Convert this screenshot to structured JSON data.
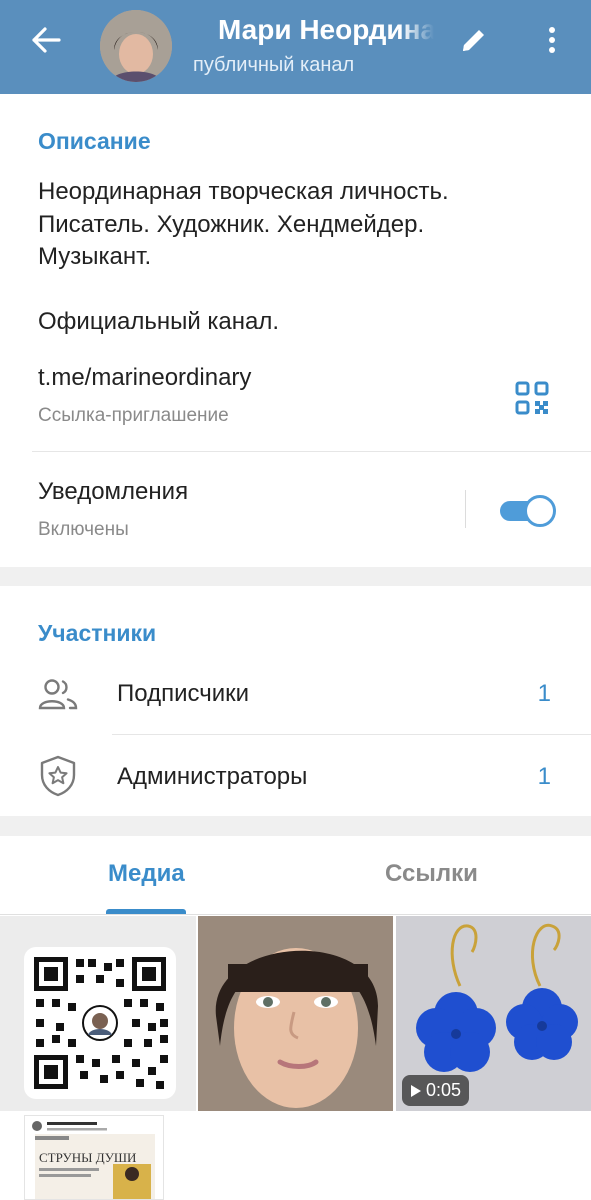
{
  "header": {
    "title": "Мари Неордина",
    "subtitle": "публичный канал"
  },
  "info": {
    "section_title": "Описание",
    "description_lines": [
      "Неординарная творческая личность.",
      "Писатель. Художник. Хендмейдер.",
      "Музыкант.",
      "Официальный канал."
    ],
    "link": "t.me/marineordinary",
    "link_caption": "Ссылка-приглашение",
    "notifications_label": "Уведомления",
    "notifications_status": "Включены",
    "notifications_on": true
  },
  "members": {
    "section_title": "Участники",
    "rows": [
      {
        "label": "Подписчики",
        "count": "1",
        "icon": "users-icon"
      },
      {
        "label": "Администраторы",
        "count": "1",
        "icon": "shield-star-icon"
      }
    ]
  },
  "tabs": [
    {
      "label": "Медиа",
      "active": true
    },
    {
      "label": "Ссылки",
      "active": false
    }
  ],
  "media": {
    "video_duration": "0:05",
    "post_thumb_text": "СТРУНЫ ДУШИ"
  },
  "colors": {
    "header_bg": "#5a8fbd",
    "accent": "#3a8cca",
    "toggle": "#4f9cd9"
  }
}
